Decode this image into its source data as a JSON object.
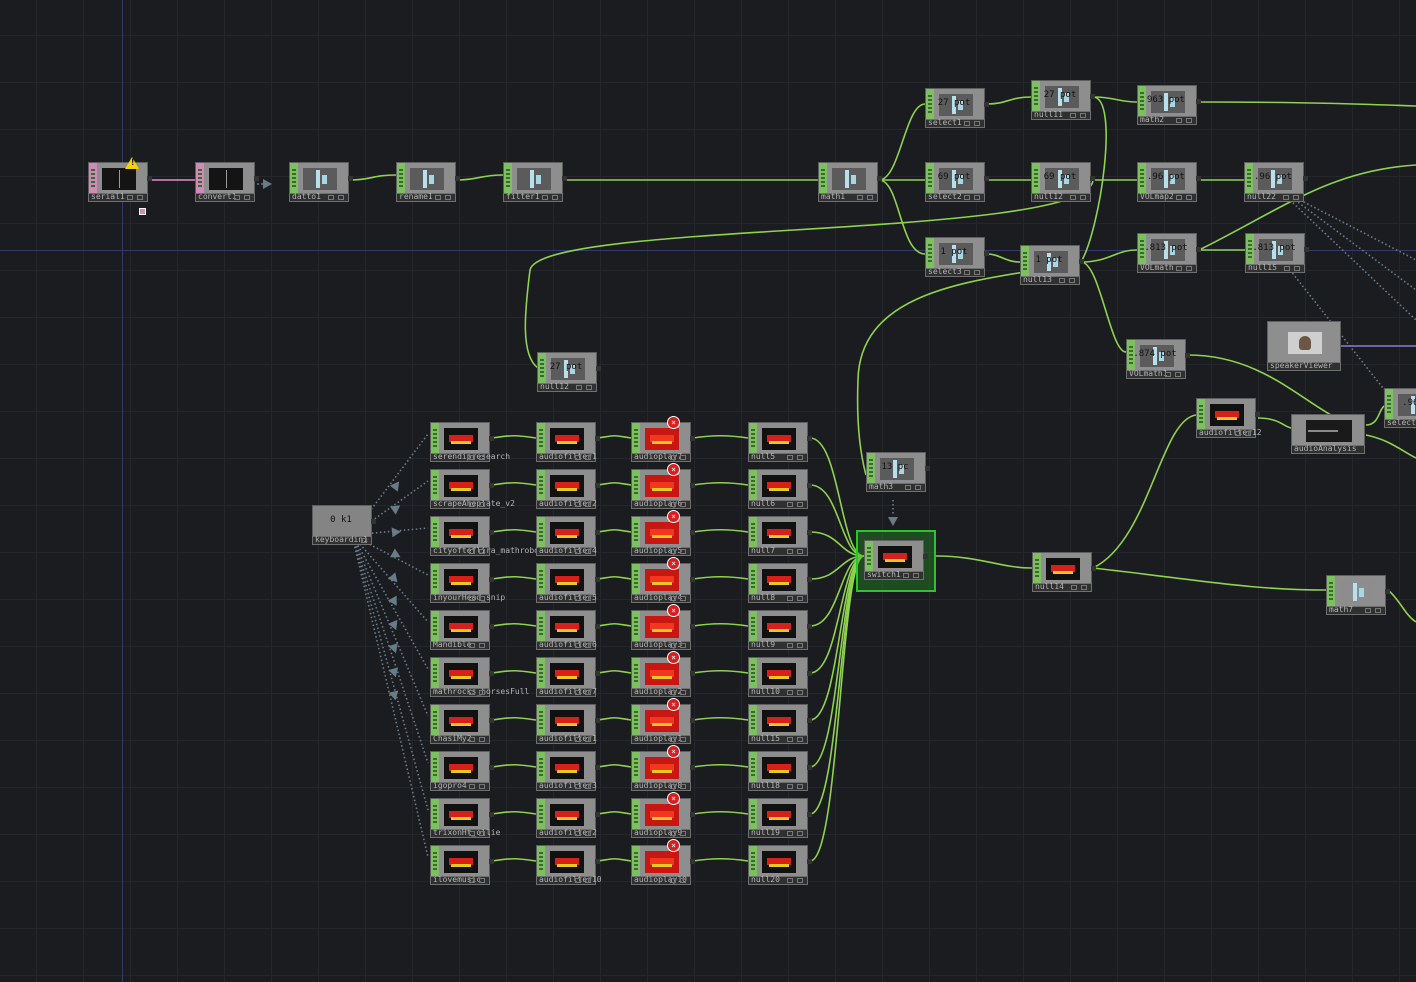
{
  "app": "TouchDesigner network editor",
  "colors": {
    "background": "#1b1c20",
    "chop_strip": "#7cc061",
    "dat_strip": "#d08ab8",
    "wire": "#8ed24d",
    "selection": "#29c629",
    "warning": "#f5d300",
    "error": "#d81e1e"
  },
  "top_chain": {
    "serial": "serial1",
    "convert": "convert1",
    "datto": "datto1",
    "rename": "rename1",
    "filter": "filter1",
    "math": "math1",
    "null": "null12"
  },
  "ops": {
    "select1": {
      "name": "select1",
      "value": "27",
      "unit": "pot"
    },
    "select2": {
      "name": "select2",
      "value": "69",
      "unit": "pot"
    },
    "select3": {
      "name": "select3",
      "value": "1",
      "unit": "pot"
    },
    "null1": {
      "name": "null11",
      "value": "27",
      "unit": "pot"
    },
    "null2": {
      "name": "null12",
      "value": "69",
      "unit": "pot"
    },
    "null3": {
      "name": "null13",
      "value": "1",
      "unit": "pot"
    },
    "math2": {
      "name": "math2",
      "value": "963",
      "unit": "pot"
    },
    "volmap2": {
      "name": "VOLmap2",
      "value": ".96",
      "unit": "pot"
    },
    "volmath": {
      "name": "VOLmath",
      "value": ".813",
      "unit": "pot"
    },
    "null22": {
      "name": "null22",
      "value": ".96",
      "unit": "pot"
    },
    "null15": {
      "name": "null15",
      "value": ".813",
      "unit": "pot"
    },
    "volmath1": {
      "name": "VOLmath1",
      "value": ".874",
      "unit": "pot"
    },
    "speakerviewer": {
      "name": "speakerViewer"
    },
    "audiofilter12": {
      "name": "audiofilter12"
    },
    "audioanalysis": {
      "name": "audioAnalysis"
    },
    "select_right": {
      "name": "select",
      "value": ".966"
    },
    "nullmid": {
      "name": "null12",
      "value": "27",
      "unit": "pot"
    },
    "keyboard": {
      "name": "keyboardin1",
      "value": "0",
      "unit": "k1"
    },
    "math3": {
      "name": "math3",
      "value": "13",
      "unit": "pc"
    },
    "switch": {
      "name": "switch1"
    },
    "null14": {
      "name": "null14"
    },
    "math7": {
      "name": "math7"
    }
  },
  "sources": [
    "serendipresearch",
    "scrapeAheplate_v2",
    "cityofteflira_mathrobotscu",
    "inyourHead_snip",
    "Mandible",
    "mathrocks_horsesFull",
    "ChasiMy2",
    "igopro4",
    "trixonHt_ollie",
    "ilovemusic"
  ],
  "filters": [
    "audiofilter1",
    "audiofilter2",
    "audiofilter4",
    "audiofilter5",
    "audiofilter6",
    "audiofilter7",
    "audiofilter1",
    "audiofilter3",
    "audiofilter2",
    "audiofilter10"
  ],
  "players": [
    "audioplay7",
    "audioplay6",
    "audioplay5",
    "audioplay4",
    "audioplay3",
    "audioplay2",
    "audioplay1",
    "audioplay8",
    "audioplay9",
    "audioplay10"
  ],
  "nulls": [
    "null5",
    "null6",
    "null7",
    "null8",
    "null9",
    "null10",
    "null15",
    "null18",
    "null19",
    "null20"
  ],
  "error_glyph": "×",
  "warning_glyph": "!"
}
